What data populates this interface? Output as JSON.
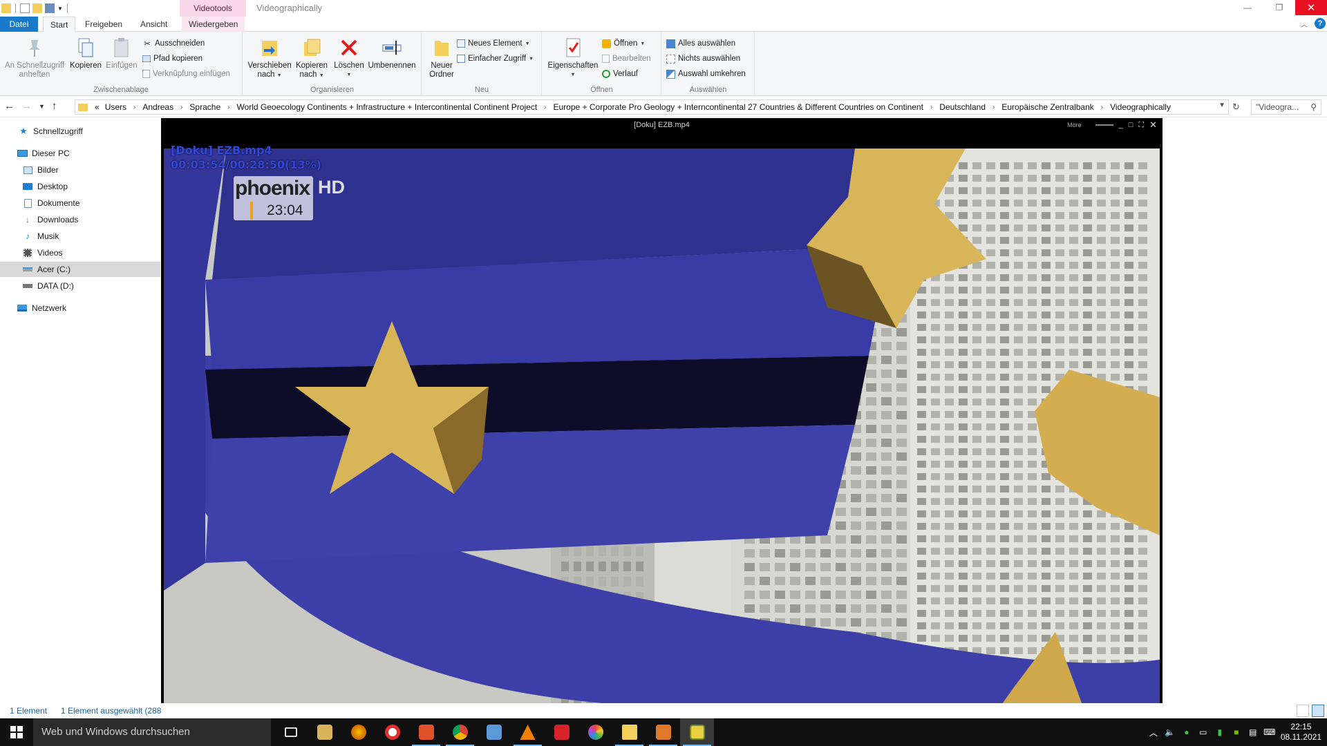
{
  "window": {
    "context_tab_header": "Videotools",
    "title": "Videographically",
    "minimize": "—",
    "maximize": "❐",
    "close": "✕"
  },
  "tabs": {
    "file": "Datei",
    "start": "Start",
    "share": "Freigeben",
    "view": "Ansicht",
    "play": "Wiedergeben"
  },
  "ribbon": {
    "clipboard": {
      "label": "Zwischenablage",
      "pin_line1": "An Schnellzugriff",
      "pin_line2": "anheften",
      "copy": "Kopieren",
      "paste": "Einfügen",
      "cut": "Ausschneiden",
      "copy_path": "Pfad kopieren",
      "paste_shortcut": "Verknüpfung einfügen"
    },
    "organize": {
      "label": "Organisieren",
      "move_line1": "Verschieben",
      "move_line2": "nach",
      "copyto_line1": "Kopieren",
      "copyto_line2": "nach",
      "delete": "Löschen",
      "rename": "Umbenennen"
    },
    "new": {
      "label": "Neu",
      "folder_line1": "Neuer",
      "folder_line2": "Ordner",
      "new_item": "Neues Element",
      "easy_access": "Einfacher Zugriff"
    },
    "open": {
      "label": "Öffnen",
      "properties": "Eigenschaften",
      "open": "Öffnen",
      "edit": "Bearbeiten",
      "history": "Verlauf"
    },
    "select": {
      "label": "Auswählen",
      "select_all": "Alles auswählen",
      "select_none": "Nichts auswählen",
      "invert": "Auswahl umkehren"
    }
  },
  "address": {
    "overflow": "«",
    "crumbs": [
      "Users",
      "Andreas",
      "Sprache",
      "World Geoecology Continents + Infrastructure + Intercontinental Continent Project",
      "Europe + Corporate Pro Geology + Interncontinental 27 Countries & Different Countries on Continent",
      "Deutschland",
      "Europäische Zentralbank",
      "Videographically"
    ],
    "search_placeholder": "\"Videogra...",
    "search_icon": "⚲"
  },
  "navpane": {
    "quick_access": "Schnellzugriff",
    "this_pc": "Dieser PC",
    "pictures": "Bilder",
    "desktop": "Desktop",
    "documents": "Dokumente",
    "downloads": "Downloads",
    "music": "Musik",
    "videos": "Videos",
    "drive_c": "Acer (C:)",
    "drive_d": "DATA (D:)",
    "network": "Netzwerk"
  },
  "player": {
    "title": "[Doku] EZB.mp4",
    "more": "More",
    "osd_file": "[Doku] EZB.mp4",
    "osd_time": "00:03:54/00:28:50(13%)",
    "channel_name": "phoenix",
    "channel_hd": "HD",
    "channel_time": "23:04",
    "progress_fraction": 0.13
  },
  "status": {
    "items": "1 Element",
    "selected": "1 Element ausgewählt (288"
  },
  "taskbar": {
    "search_placeholder": "Web und Windows durchsuchen",
    "time": "22:15",
    "date": "08.11.2021"
  },
  "colors": {
    "accent": "#1979ca",
    "video_tab": "#fbe5f1",
    "close": "#e81123",
    "euro_blue": "#3d3fa8",
    "star_gold": "#d9b55a"
  }
}
